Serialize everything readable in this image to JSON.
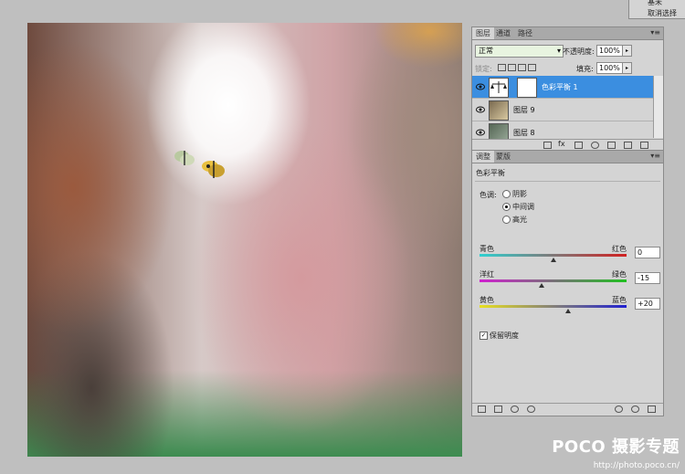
{
  "top_menu": {
    "item1": "基未",
    "item2": "取消选择"
  },
  "layers_panel": {
    "tabs": [
      "图层",
      "通道",
      "路径"
    ],
    "blend_mode": "正常",
    "opacity_label": "不透明度:",
    "opacity_value": "100%",
    "lock_label": "锁定:",
    "fill_label": "填充:",
    "fill_value": "100%",
    "layers": [
      {
        "name": "色彩平衡 1",
        "selected": true
      },
      {
        "name": "图层 9",
        "selected": false
      },
      {
        "name": "图层 8",
        "selected": false
      }
    ]
  },
  "adjust_panel": {
    "tabs": [
      "调整",
      "蒙版"
    ],
    "title": "色彩平衡",
    "tone_label": "色调:",
    "tones": [
      {
        "label": "阴影",
        "selected": false
      },
      {
        "label": "中间调",
        "selected": true
      },
      {
        "label": "高光",
        "selected": false
      }
    ],
    "sliders": [
      {
        "left": "青色",
        "right": "红色",
        "value": "0",
        "level": 0,
        "colors": [
          "#2fd0d0",
          "#d02020"
        ]
      },
      {
        "left": "洋红",
        "right": "绿色",
        "value": "-15",
        "level": -15,
        "colors": [
          "#d020d0",
          "#20c020"
        ]
      },
      {
        "left": "黄色",
        "right": "蓝色",
        "value": "+20",
        "level": 20,
        "colors": [
          "#e8e020",
          "#2020d0"
        ]
      }
    ],
    "preserve_label": "保留明度",
    "preserve_checked": true
  },
  "watermark": {
    "brand": "POCO 摄影专题",
    "url": "http://photo.poco.cn/"
  }
}
